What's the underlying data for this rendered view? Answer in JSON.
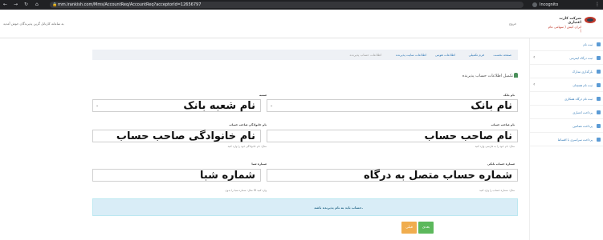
{
  "browser": {
    "url": "mm.irankish.com/Mms/AccountReq/AccountReq?acceptorId=12656797",
    "mode": "Incognito"
  },
  "header": {
    "welcome": "به سامانه کارتابل گرین پذیرندگان خوش آمدید",
    "brand_line1": "شرکت کارت اعتباری",
    "brand_line2": "ایران کیش ( سهامی عام )",
    "logout": "خروج"
  },
  "sidebar": {
    "items": [
      {
        "label": "ثبت نام"
      },
      {
        "label": "ثبت درگاه اینترنتی"
      },
      {
        "label": "بارگذاری مدارک"
      },
      {
        "label": "ثبت نام همچنان"
      },
      {
        "label": "ثبت نام درگاه همکاری"
      },
      {
        "label": "پرداخت اعتباری"
      },
      {
        "label": "پرداخت تضامین"
      },
      {
        "label": "پرداخت سراسری با اقساط"
      }
    ]
  },
  "breadcrumb": {
    "items": [
      "صفحه نخست",
      "فرم تکمیلی",
      "اطلاعات هویتی",
      "اطلاعات سایت پذیرنده",
      "اطلاعات حساب پذیرنده"
    ]
  },
  "form": {
    "title": "تکمیل اطلاعات حساب پذیرنده",
    "bank_label": "نام بانک",
    "bank_value": "نام بانک",
    "branch_label": "شعبه",
    "branch_value": "نام شعبه بانک",
    "owner_name_label": "نام صاحب حساب",
    "owner_name_value": "نام صاحب حساب",
    "owner_name_help": "مثال: نام خود را به فارسی وارد کنید",
    "owner_family_label": "نام خانوادگی صاحب حساب",
    "owner_family_value": "نام خانوادگی صاحب حساب",
    "owner_family_help": "مثال: نام خانوادگی خود را وارد کنید",
    "account_label": "شماره حساب بانکی",
    "account_value": "شماره حساب متصل به درگاه",
    "account_help": "مثال: شماره حساب را وارد کنید",
    "sheba_label": "شماره شبا",
    "sheba_value": "شماره شبا",
    "sheba_help": "مثال: شماره شبا را بدون IR وارد کنید"
  },
  "alert": {
    "text": "حساب باید به نام پذیرنده باشد."
  },
  "buttons": {
    "next": "بعدی",
    "prev": "قبلی"
  }
}
